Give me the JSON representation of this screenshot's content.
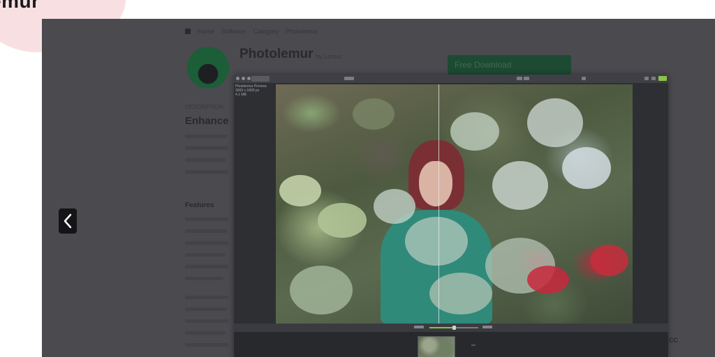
{
  "page": {
    "title_fragment": "emur"
  },
  "underlying_page": {
    "breadcrumb": [
      "Home",
      "Software",
      "Category",
      "Photolemur"
    ],
    "app_name": "Photolemur",
    "app_by": "by Lemur",
    "app_subtitle": "",
    "download_label": "Free Download",
    "section_label": "DESCRIPTION",
    "heading": "Enhance",
    "features_heading": "Features",
    "cc_text": "CC"
  },
  "lightbox": {
    "prev_icon": "chevron-left-icon"
  },
  "app_window": {
    "photo_info": "Photolemur Preview\n3000 x 1800 px\n4.1 MB",
    "accent_color": "#8bc34a",
    "slider_value": 0.5
  }
}
